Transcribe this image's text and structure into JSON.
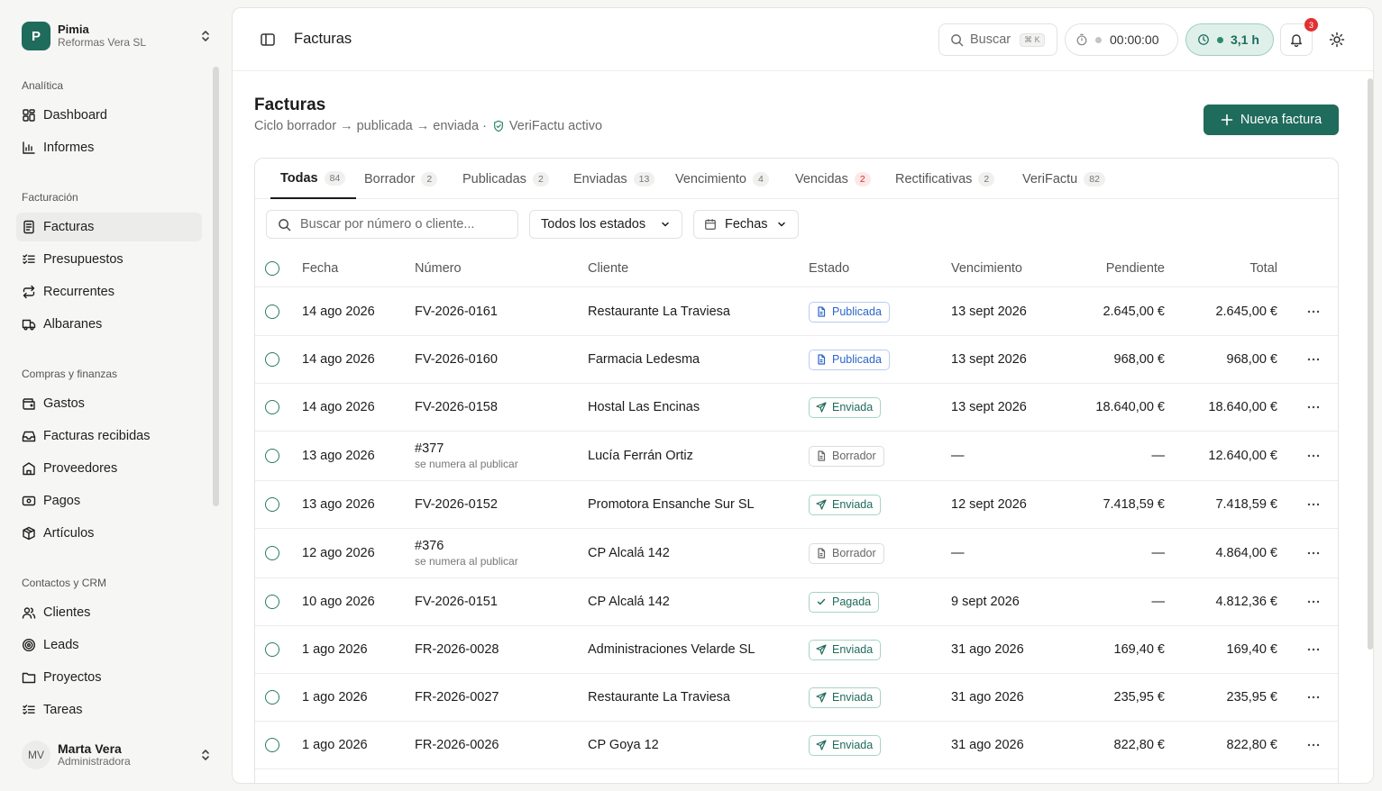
{
  "org": {
    "initial": "P",
    "name": "Pimia",
    "company": "Reformas Vera SL"
  },
  "nav": {
    "groups": [
      {
        "title": "Analítica"
      },
      {
        "title": "Facturación"
      },
      {
        "title": "Compras y finanzas"
      },
      {
        "title": "Contactos y CRM"
      }
    ],
    "items": [
      {
        "label": "Dashboard",
        "icon": "dashboard-icon"
      },
      {
        "label": "Informes",
        "icon": "chart-icon"
      },
      {
        "label": "Facturas",
        "icon": "document-icon",
        "active": true
      },
      {
        "label": "Presupuestos",
        "icon": "list-check-icon"
      },
      {
        "label": "Recurrentes",
        "icon": "repeat-icon"
      },
      {
        "label": "Albaranes",
        "icon": "truck-icon"
      },
      {
        "label": "Gastos",
        "icon": "wallet-icon"
      },
      {
        "label": "Facturas recibidas",
        "icon": "inbox-icon"
      },
      {
        "label": "Proveedores",
        "icon": "building-icon"
      },
      {
        "label": "Pagos",
        "icon": "bank-icon"
      },
      {
        "label": "Artículos",
        "icon": "package-icon"
      },
      {
        "label": "Clientes",
        "icon": "users-icon"
      },
      {
        "label": "Leads",
        "icon": "target-icon"
      },
      {
        "label": "Proyectos",
        "icon": "folder-icon"
      },
      {
        "label": "Tareas",
        "icon": "tasks-icon"
      }
    ]
  },
  "user": {
    "initials": "MV",
    "name": "Marta Vera",
    "role": "Administradora"
  },
  "topbar": {
    "title": "Facturas",
    "search_label": "Buscar",
    "search_kbd": "⌘ K",
    "timer": "00:00:00",
    "hours": "3,1 h",
    "notifications": "3"
  },
  "page": {
    "title": "Facturas",
    "subtitle": "Ciclo borrador → publicada → enviada ·",
    "verifactu": "VeriFactu activo",
    "new_button": "Nueva factura"
  },
  "tabs": [
    {
      "label": "Todas",
      "count": "84",
      "active": true
    },
    {
      "label": "Borrador",
      "count": "2"
    },
    {
      "label": "Publicadas",
      "count": "2"
    },
    {
      "label": "Enviadas",
      "count": "13"
    },
    {
      "label": "Vencimiento",
      "count": "4"
    },
    {
      "label": "Vencidas",
      "count": "2",
      "alert": true
    },
    {
      "label": "Rectificativas",
      "count": "2"
    },
    {
      "label": "VeriFactu",
      "count": "82"
    }
  ],
  "filters": {
    "search_placeholder": "Buscar por número o cliente...",
    "state": "Todos los estados",
    "dates": "Fechas"
  },
  "columns": {
    "fecha": "Fecha",
    "numero": "Número",
    "cliente": "Cliente",
    "estado": "Estado",
    "vencimiento": "Vencimiento",
    "pendiente": "Pendiente",
    "total": "Total"
  },
  "rows": [
    {
      "fecha": "14 ago 2026",
      "numero": "FV-2026-0161",
      "nota": "",
      "cliente": "Restaurante La Traviesa",
      "estado": "Publicada",
      "vencimiento": "13 sept 2026",
      "pendiente": "2.645,00 €",
      "total": "2.645,00 €"
    },
    {
      "fecha": "14 ago 2026",
      "numero": "FV-2026-0160",
      "nota": "",
      "cliente": "Farmacia Ledesma",
      "estado": "Publicada",
      "vencimiento": "13 sept 2026",
      "pendiente": "968,00 €",
      "total": "968,00 €"
    },
    {
      "fecha": "14 ago 2026",
      "numero": "FV-2026-0158",
      "nota": "",
      "cliente": "Hostal Las Encinas",
      "estado": "Enviada",
      "vencimiento": "13 sept 2026",
      "pendiente": "18.640,00 €",
      "total": "18.640,00 €"
    },
    {
      "fecha": "13 ago 2026",
      "numero": "#377",
      "nota": "se numera al publicar",
      "cliente": "Lucía Ferrán Ortiz",
      "estado": "Borrador",
      "vencimiento": "—",
      "pendiente": "—",
      "total": "12.640,00 €"
    },
    {
      "fecha": "13 ago 2026",
      "numero": "FV-2026-0152",
      "nota": "",
      "cliente": "Promotora Ensanche Sur SL",
      "estado": "Enviada",
      "vencimiento": "12 sept 2026",
      "pendiente": "7.418,59 €",
      "total": "7.418,59 €"
    },
    {
      "fecha": "12 ago 2026",
      "numero": "#376",
      "nota": "se numera al publicar",
      "cliente": "CP Alcalá 142",
      "estado": "Borrador",
      "vencimiento": "—",
      "pendiente": "—",
      "total": "4.864,00 €"
    },
    {
      "fecha": "10 ago 2026",
      "numero": "FV-2026-0151",
      "nota": "",
      "cliente": "CP Alcalá 142",
      "estado": "Pagada",
      "vencimiento": "9 sept 2026",
      "pendiente": "—",
      "total": "4.812,36 €"
    },
    {
      "fecha": "1 ago 2026",
      "numero": "FR-2026-0028",
      "nota": "",
      "cliente": "Administraciones Velarde SL",
      "estado": "Enviada",
      "vencimiento": "31 ago 2026",
      "pendiente": "169,40 €",
      "total": "169,40 €"
    },
    {
      "fecha": "1 ago 2026",
      "numero": "FR-2026-0027",
      "nota": "",
      "cliente": "Restaurante La Traviesa",
      "estado": "Enviada",
      "vencimiento": "31 ago 2026",
      "pendiente": "235,95 €",
      "total": "235,95 €"
    },
    {
      "fecha": "1 ago 2026",
      "numero": "FR-2026-0026",
      "nota": "",
      "cliente": "CP Goya 12",
      "estado": "Enviada",
      "vencimiento": "31 ago 2026",
      "pendiente": "822,80 €",
      "total": "822,80 €"
    }
  ],
  "colors": {
    "brand": "#1f6b5c",
    "publicada": "#2a66c8",
    "alert": "#e03131"
  }
}
